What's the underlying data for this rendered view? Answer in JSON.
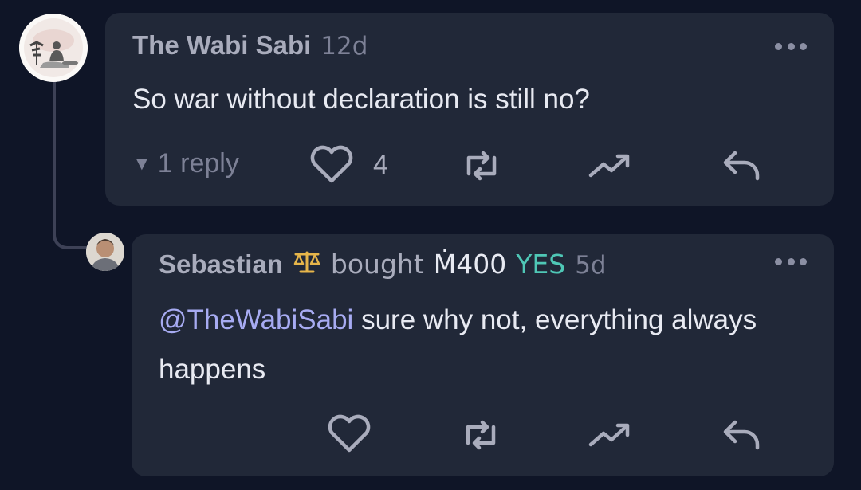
{
  "comments": [
    {
      "author": "The Wabi Sabi",
      "time": "12d",
      "text": "So war without declaration is still no?",
      "replies_label": "1 reply",
      "likes": "4",
      "avatar_icon": "zen-monk-avatar"
    },
    {
      "author": "Sebastian",
      "badge_icon": "scale-icon",
      "action": "bought",
      "amount": "Ṁ400",
      "outcome": "YES",
      "time": "5d",
      "mention": "@TheWabiSabi",
      "text": " sure why not, everything always happens",
      "avatar_icon": "user-photo-avatar"
    }
  ],
  "colors": {
    "background": "#0f1527",
    "card": "#212838",
    "yes": "#4fc7b6",
    "mention": "#a7abf2",
    "badge": "#e6b54a"
  }
}
